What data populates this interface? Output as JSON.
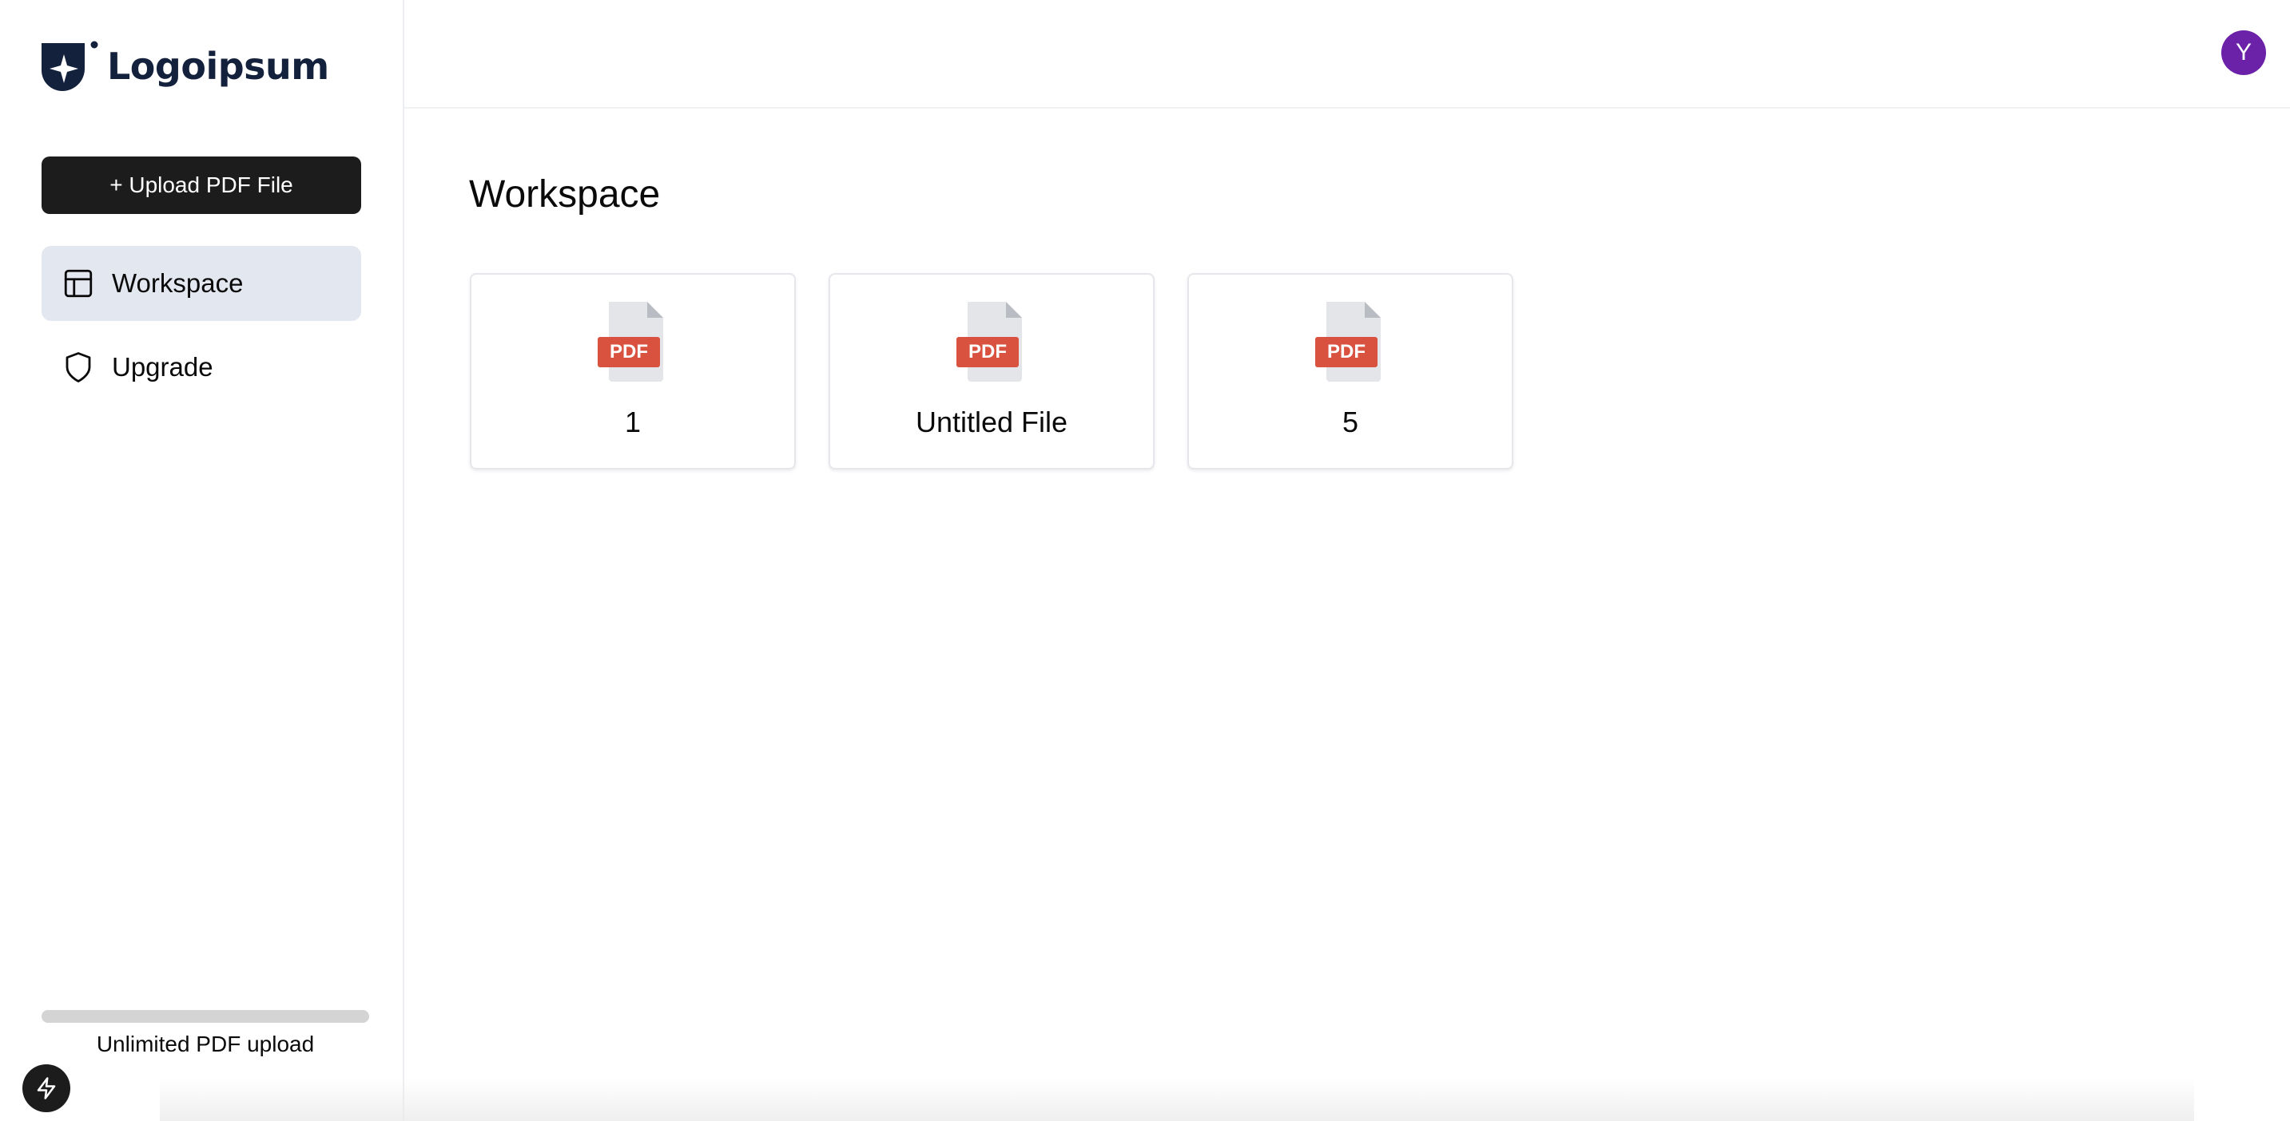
{
  "app": {
    "logo_text": "Logoipsum",
    "accent_color": "#1c1c1c",
    "brand_color": "#14213d"
  },
  "sidebar": {
    "upload_button_label": "+ Upload PDF File",
    "items": [
      {
        "label": "Workspace",
        "icon": "layout-icon",
        "active": true
      },
      {
        "label": "Upgrade",
        "icon": "shield-icon",
        "active": false
      }
    ],
    "usage": {
      "progress": 1.0,
      "label": "Unlimited PDF upload"
    },
    "bolt_icon": "bolt-icon"
  },
  "header": {
    "avatar_initial": "Y",
    "avatar_color": "#6b21a8"
  },
  "main": {
    "title": "Workspace",
    "files": [
      {
        "name": "1",
        "type_label": "PDF"
      },
      {
        "name": "Untitled File",
        "type_label": "PDF"
      },
      {
        "name": "5",
        "type_label": "PDF"
      }
    ],
    "pdf_badge_color": "#d9523f"
  }
}
